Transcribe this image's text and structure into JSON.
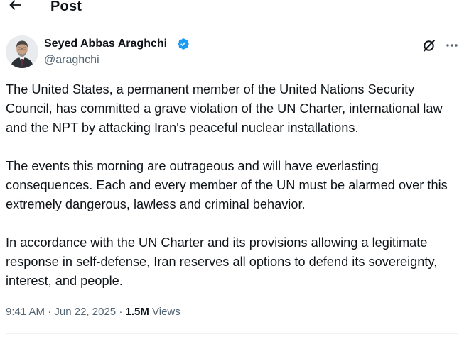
{
  "header": {
    "title": "Post",
    "back_icon": "arrow-left-icon"
  },
  "author": {
    "name": "Seyed Abbas Araghchi",
    "handle": "@araghchi",
    "verified": true,
    "verified_color": "#1d9bf0",
    "avatar_icon": "avatar-photo"
  },
  "actions": {
    "grok_icon": "grok-icon",
    "more_icon": "more-icon"
  },
  "tweet": {
    "paragraphs": [
      "The United States, a permanent member of the United Nations Security Council, has committed a grave violation of the UN Charter, international law and the NPT by attacking Iran's peaceful nuclear installations.",
      "The events this morning are outrageous and will have everlasting consequences. Each and every member of the UN must be alarmed over this extremely dangerous, lawless and criminal behavior.",
      "In accordance with the UN Charter and its provisions allowing a legitimate response in self-defense, Iran reserves all options to defend its sovereignty, interest, and people."
    ]
  },
  "meta": {
    "time": "9:41 AM",
    "date": "Jun 22, 2025",
    "separator": "·",
    "views_count": "1.5M",
    "views_label": "Views"
  },
  "colors": {
    "text_primary": "#0f1419",
    "text_secondary": "#536471",
    "divider": "#eff3f4"
  }
}
